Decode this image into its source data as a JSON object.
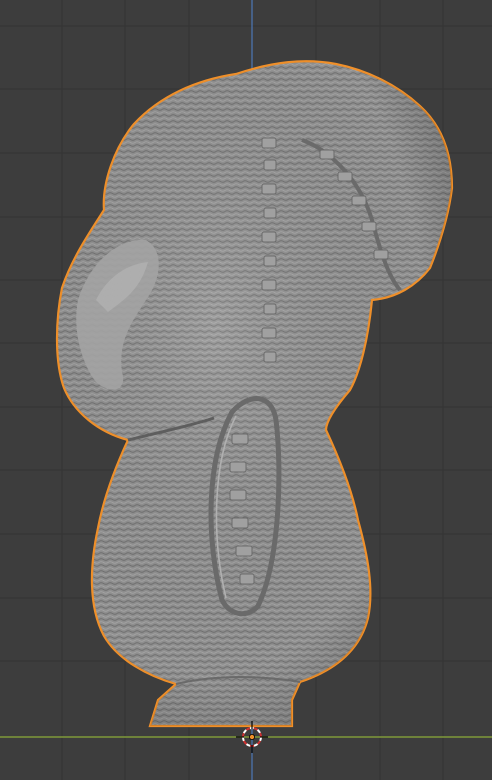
{
  "viewport": {
    "background": "#3d3d3d",
    "grid_color": "#333333",
    "x_axis_color": "#7f9a3a",
    "z_axis_color": "#4a6fa5",
    "selection_outline_color": "#f0902a",
    "mesh_color": "#8e8e8e"
  },
  "scene": {
    "selected_object": {
      "icon": "mesh-object",
      "selected": true,
      "surface": "sculpted-noise-displacement"
    },
    "cursor": {
      "icon": "3d-cursor-icon"
    },
    "origin": {
      "icon": "object-origin-icon"
    }
  }
}
